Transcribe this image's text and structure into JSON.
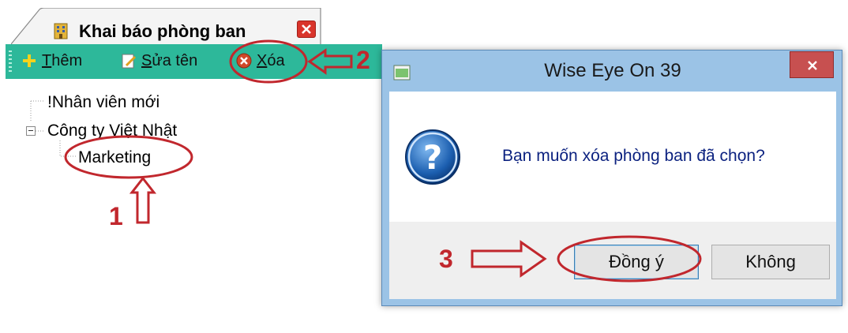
{
  "tab": {
    "title": "Khai báo phòng ban",
    "icon": "building-icon",
    "close_icon": "close-icon"
  },
  "toolbar": {
    "add": {
      "icon": "plus-icon",
      "label_ul": "T",
      "label_rest": "hêm"
    },
    "rename": {
      "icon": "edit-icon",
      "label_ul": "S",
      "label_rest": "ửa tên"
    },
    "delete": {
      "icon": "delete-icon",
      "label_ul": "X",
      "label_rest": "óa"
    }
  },
  "tree": {
    "nodes": [
      {
        "label": "!Nhân viên mới"
      },
      {
        "label": "Công ty Việt Nhật",
        "expanded": true
      },
      {
        "label": "Marketing",
        "selected": true
      }
    ]
  },
  "dialog": {
    "title": "Wise Eye On 39",
    "message": "Bạn muốn xóa phòng ban đã chọn?",
    "icon": "question-icon",
    "buttons": {
      "yes": "Đồng ý",
      "no": "Không"
    }
  },
  "annotations": {
    "step1": "1",
    "step2": "2",
    "step3": "3",
    "color": "#c1272d"
  },
  "colors": {
    "toolbar": "#2db89a",
    "dialog_frame": "#9bc3e6",
    "message_text": "#0c2280"
  }
}
